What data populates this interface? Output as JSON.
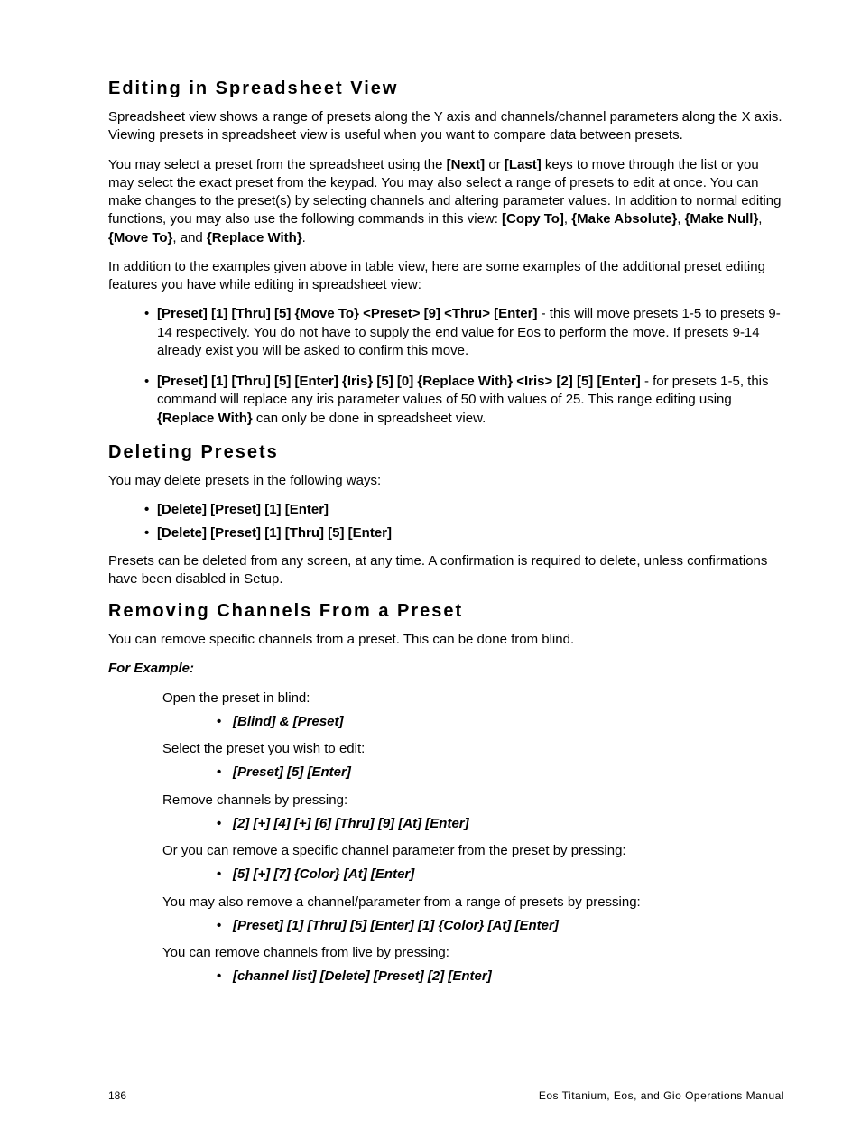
{
  "section1": {
    "heading": "Editing in Spreadsheet View",
    "p1": "Spreadsheet view shows a range of presets along the Y axis and channels/channel parameters along the X axis. Viewing presets in spreadsheet view is useful when you want to compare data between presets.",
    "p2_pre": "You may select a preset from the spreadsheet using the ",
    "p2_next": "[Next]",
    "p2_or": " or ",
    "p2_last": "[Last]",
    "p2_mid": " keys to move through the list or you may select the exact preset from the keypad. You may also select a range of presets to edit at once. You can make changes to the preset(s) by selecting channels and altering parameter values. In addition to normal editing functions, you may also use the following commands in this view: ",
    "p2_c1": "[Copy To]",
    "p2_s1": ", ",
    "p2_c2": "{Make Absolute}",
    "p2_s2": ", ",
    "p2_c3": "{Make Null}",
    "p2_s3": ", ",
    "p2_c4": "{Move To}",
    "p2_s4": ", and ",
    "p2_c5": "{Replace With}",
    "p2_end": ".",
    "p3": "In addition to the examples given above in table view, here are some examples of the additional preset editing features you have while editing in spreadsheet view:",
    "b1_cmd": "[Preset] [1] [Thru] [5] {Move To} <Preset> [9] <Thru> [Enter]",
    "b1_txt": " - this will move presets 1-5 to presets 9-14 respectively. You do not have to supply the end value for Eos to perform the move. If presets 9-14 already exist you will be asked to confirm this move.",
    "b2_cmd": "[Preset] [1] [Thru] [5] [Enter] {Iris} [5] [0] {Replace With} <Iris> [2] [5] [Enter]",
    "b2_txt1": " - for presets 1-5, this command will replace any iris parameter values of 50 with values of 25. This range editing using ",
    "b2_rw": "{Replace With}",
    "b2_txt2": " can only be done in spreadsheet view."
  },
  "section2": {
    "heading": "Deleting Presets",
    "p1": "You may delete presets in the following ways:",
    "b1": "[Delete] [Preset] [1] [Enter]",
    "b2": "[Delete] [Preset] [1] [Thru] [5] [Enter]",
    "p2": "Presets can be deleted from any screen, at any time. A confirmation is required to delete, unless confirmations have been disabled in Setup."
  },
  "section3": {
    "heading": "Removing Channels From a Preset",
    "p1": "You can remove specific channels from a preset. This can be done from blind.",
    "example_label": "For Example:",
    "e1": "Open the preset in blind:",
    "e1_cmd": "[Blind] & [Preset]",
    "e2": "Select the preset you wish to edit:",
    "e2_cmd": "[Preset] [5] [Enter]",
    "e3": "Remove channels by pressing:",
    "e3_cmd": "[2] [+] [4] [+] [6] [Thru] [9] [At] [Enter]",
    "e4": "Or you can remove a specific channel parameter from the preset by pressing:",
    "e4_cmd": "[5] [+] [7] {Color} [At] [Enter]",
    "e5": "You may also remove a channel/parameter from a range of presets by pressing:",
    "e5_cmd": "[Preset] [1] [Thru] [5] [Enter] [1] {Color} [At] [Enter]",
    "e6": "You can remove channels from live by pressing:",
    "e6_cmd": "[channel list] [Delete] [Preset] [2] [Enter]"
  },
  "footer": {
    "page": "186",
    "title": "Eos Titanium, Eos, and Gio Operations Manual"
  }
}
